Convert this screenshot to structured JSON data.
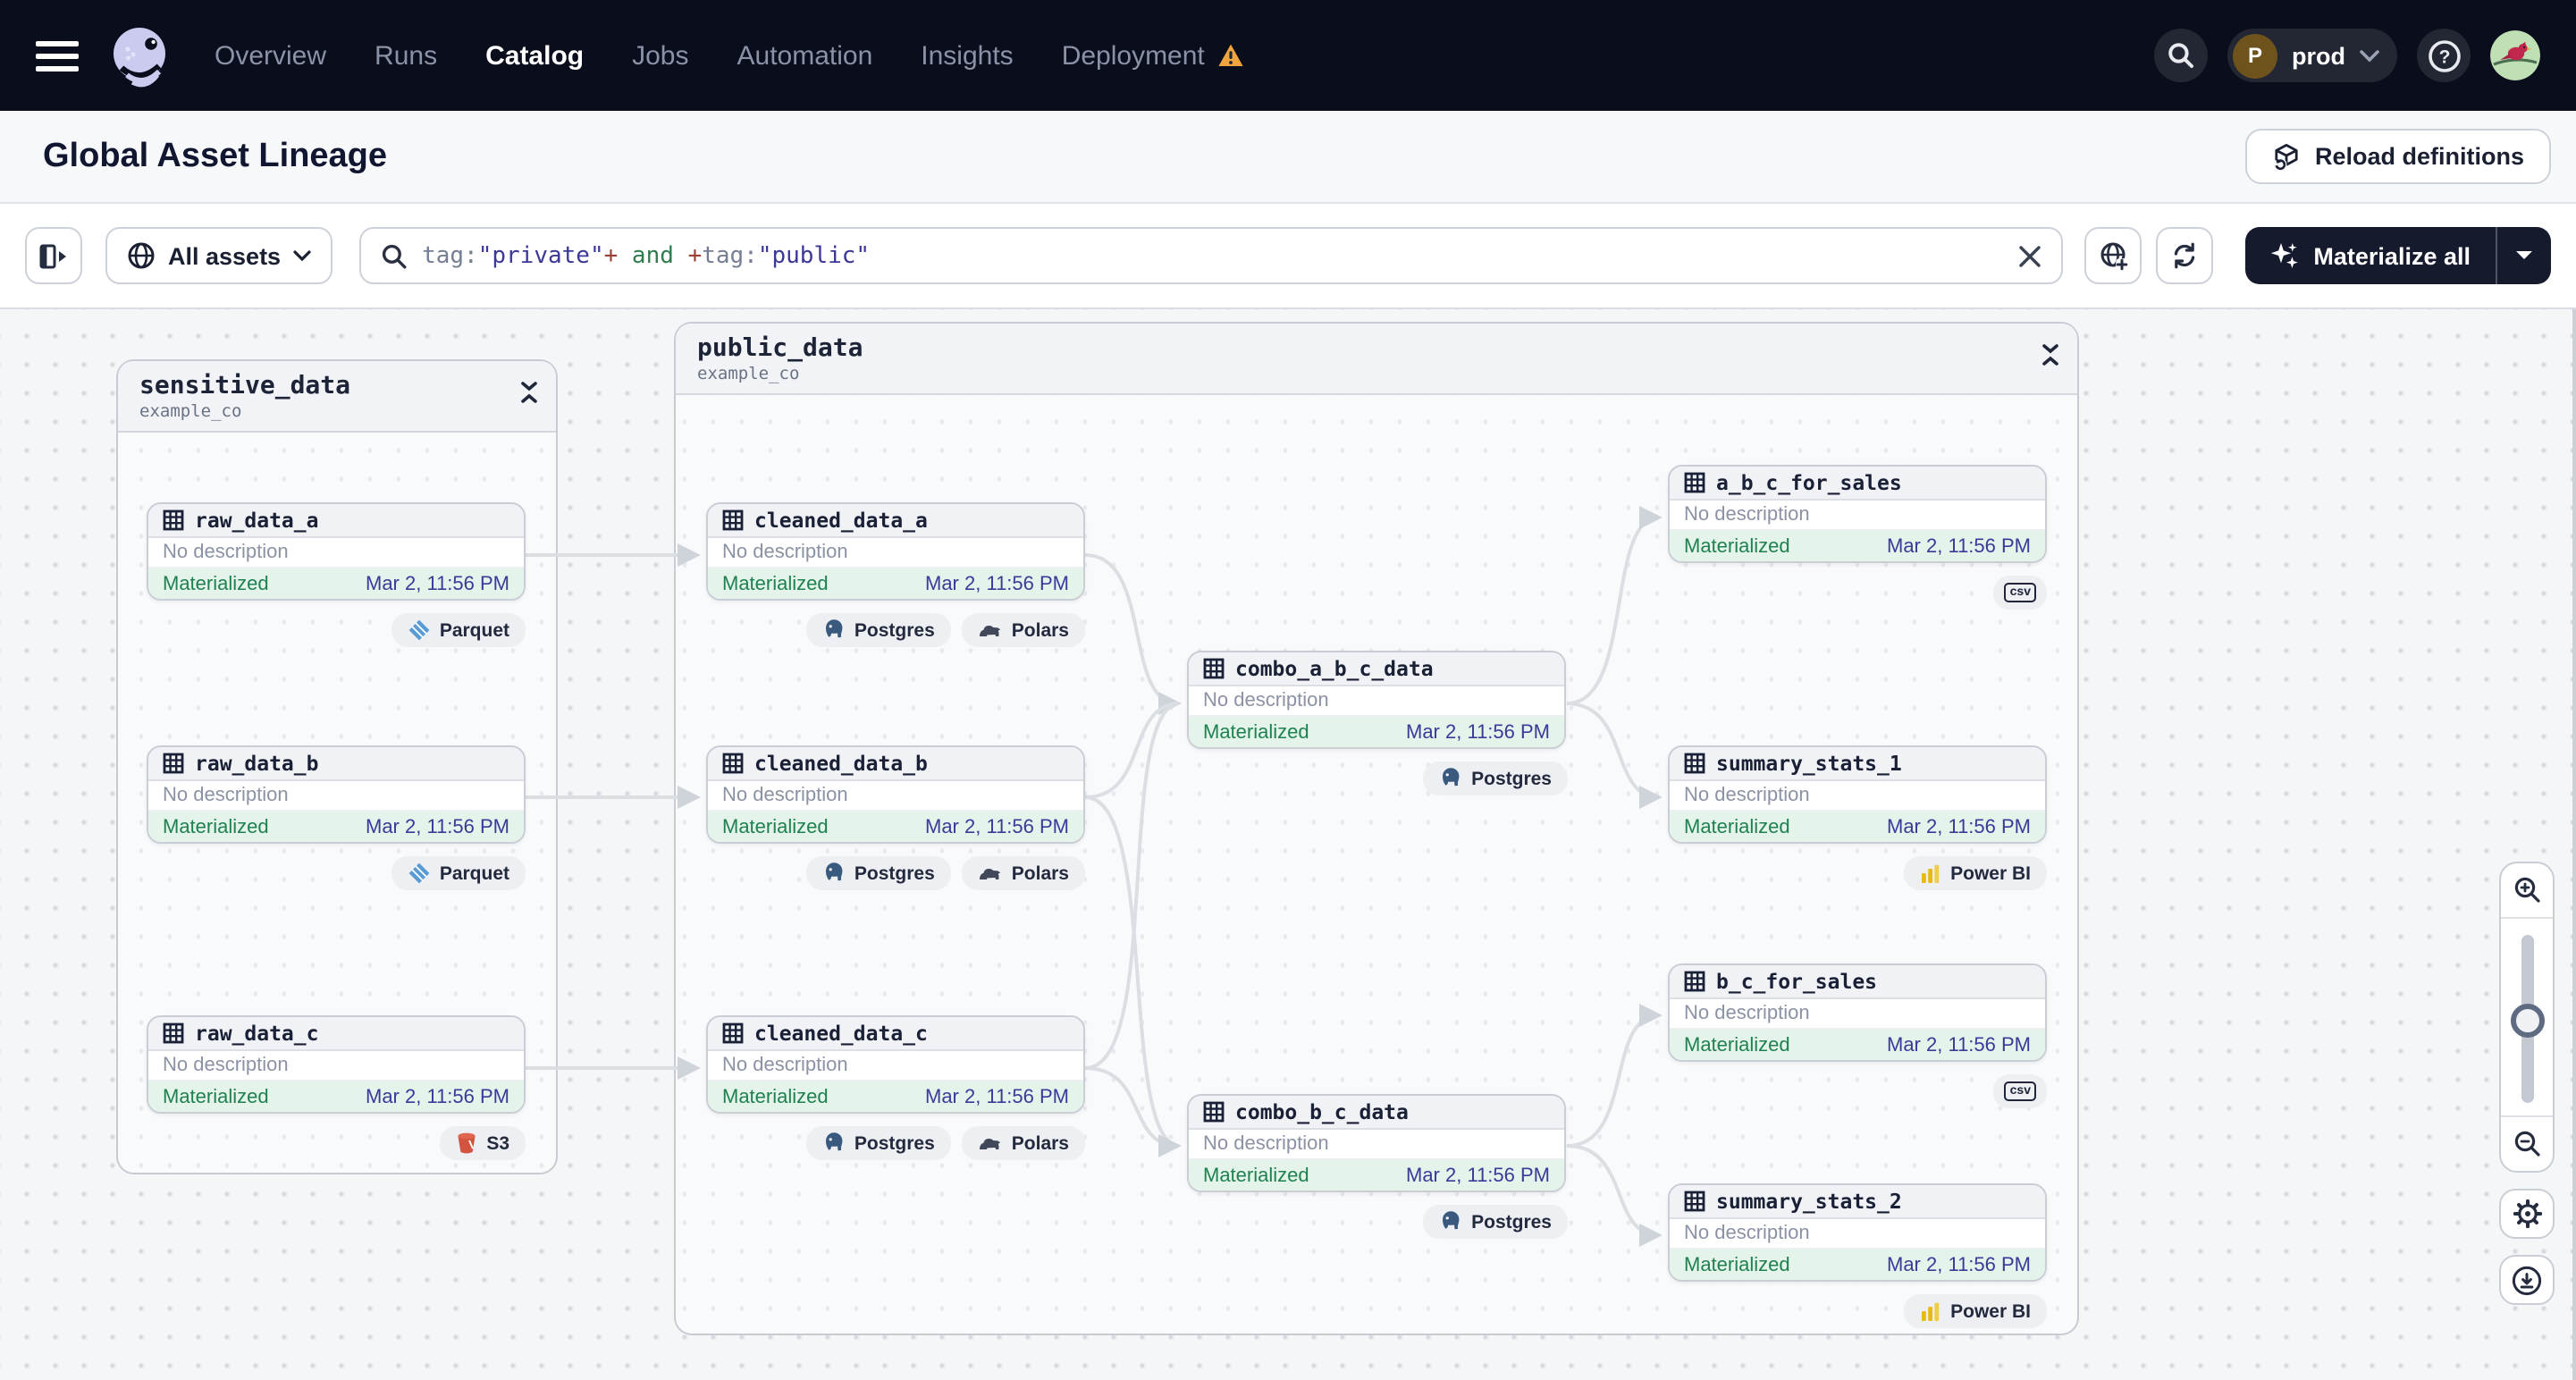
{
  "nav": {
    "items": [
      "Overview",
      "Runs",
      "Catalog",
      "Jobs",
      "Automation",
      "Insights",
      "Deployment"
    ],
    "active_item": "Catalog",
    "env": "prod",
    "env_initial": "P"
  },
  "header": {
    "title": "Global Asset Lineage",
    "reload_label": "Reload definitions"
  },
  "toolbar": {
    "filter_label": "All assets",
    "materialize_label": "Materialize all",
    "query": [
      {
        "t": "tag:"
      },
      {
        "t": "\"private\""
      },
      {
        "t": "+"
      },
      {
        "t": " and "
      },
      {
        "t": "+"
      },
      {
        "t": "tag:"
      },
      {
        "t": "\"public\""
      }
    ]
  },
  "groups": [
    {
      "name": "sensitive_data",
      "repo": "example_co",
      "assets": [
        {
          "name": "raw_data_a",
          "description": "No description",
          "status": "Materialized",
          "timestamp": "Mar 2, 11:56 PM",
          "badges": [
            "Parquet"
          ]
        },
        {
          "name": "raw_data_b",
          "description": "No description",
          "status": "Materialized",
          "timestamp": "Mar 2, 11:56 PM",
          "badges": [
            "Parquet"
          ]
        },
        {
          "name": "raw_data_c",
          "description": "No description",
          "status": "Materialized",
          "timestamp": "Mar 2, 11:56 PM",
          "badges": [
            "S3"
          ]
        }
      ]
    },
    {
      "name": "public_data",
      "repo": "example_co",
      "assets": [
        {
          "name": "cleaned_data_a",
          "description": "No description",
          "status": "Materialized",
          "timestamp": "Mar 2, 11:56 PM",
          "badges": [
            "Postgres",
            "Polars"
          ]
        },
        {
          "name": "cleaned_data_b",
          "description": "No description",
          "status": "Materialized",
          "timestamp": "Mar 2, 11:56 PM",
          "badges": [
            "Postgres",
            "Polars"
          ]
        },
        {
          "name": "cleaned_data_c",
          "description": "No description",
          "status": "Materialized",
          "timestamp": "Mar 2, 11:56 PM",
          "badges": [
            "Postgres",
            "Polars"
          ]
        },
        {
          "name": "combo_a_b_c_data",
          "description": "No description",
          "status": "Materialized",
          "timestamp": "Mar 2, 11:56 PM",
          "badges": [
            "Postgres"
          ]
        },
        {
          "name": "a_b_c_for_sales",
          "description": "No description",
          "status": "Materialized",
          "timestamp": "Mar 2, 11:56 PM",
          "badges": [
            "csv"
          ]
        },
        {
          "name": "summary_stats_1",
          "description": "No description",
          "status": "Materialized",
          "timestamp": "Mar 2, 11:56 PM",
          "badges": [
            "Power BI"
          ]
        },
        {
          "name": "b_c_for_sales",
          "description": "No description",
          "status": "Materialized",
          "timestamp": "Mar 2, 11:56 PM",
          "badges": [
            "csv"
          ]
        },
        {
          "name": "combo_b_c_data",
          "description": "No description",
          "status": "Materialized",
          "timestamp": "Mar 2, 11:56 PM",
          "badges": [
            "Postgres"
          ]
        },
        {
          "name": "summary_stats_2",
          "description": "No description",
          "status": "Materialized",
          "timestamp": "Mar 2, 11:56 PM",
          "badges": [
            "Power BI"
          ]
        }
      ]
    }
  ],
  "colors": {
    "nav_bg": "#0A0D1C",
    "warning": "#F0A33F",
    "materialized_green": "#1F8150",
    "timestamp_indigo": "#3A3A99",
    "query_value": "#3B3897",
    "query_operator": "#9A4034",
    "query_bool": "#2F7D4E",
    "edge": "#DBDEE3",
    "canvas_bg": "#F5F6F8"
  }
}
